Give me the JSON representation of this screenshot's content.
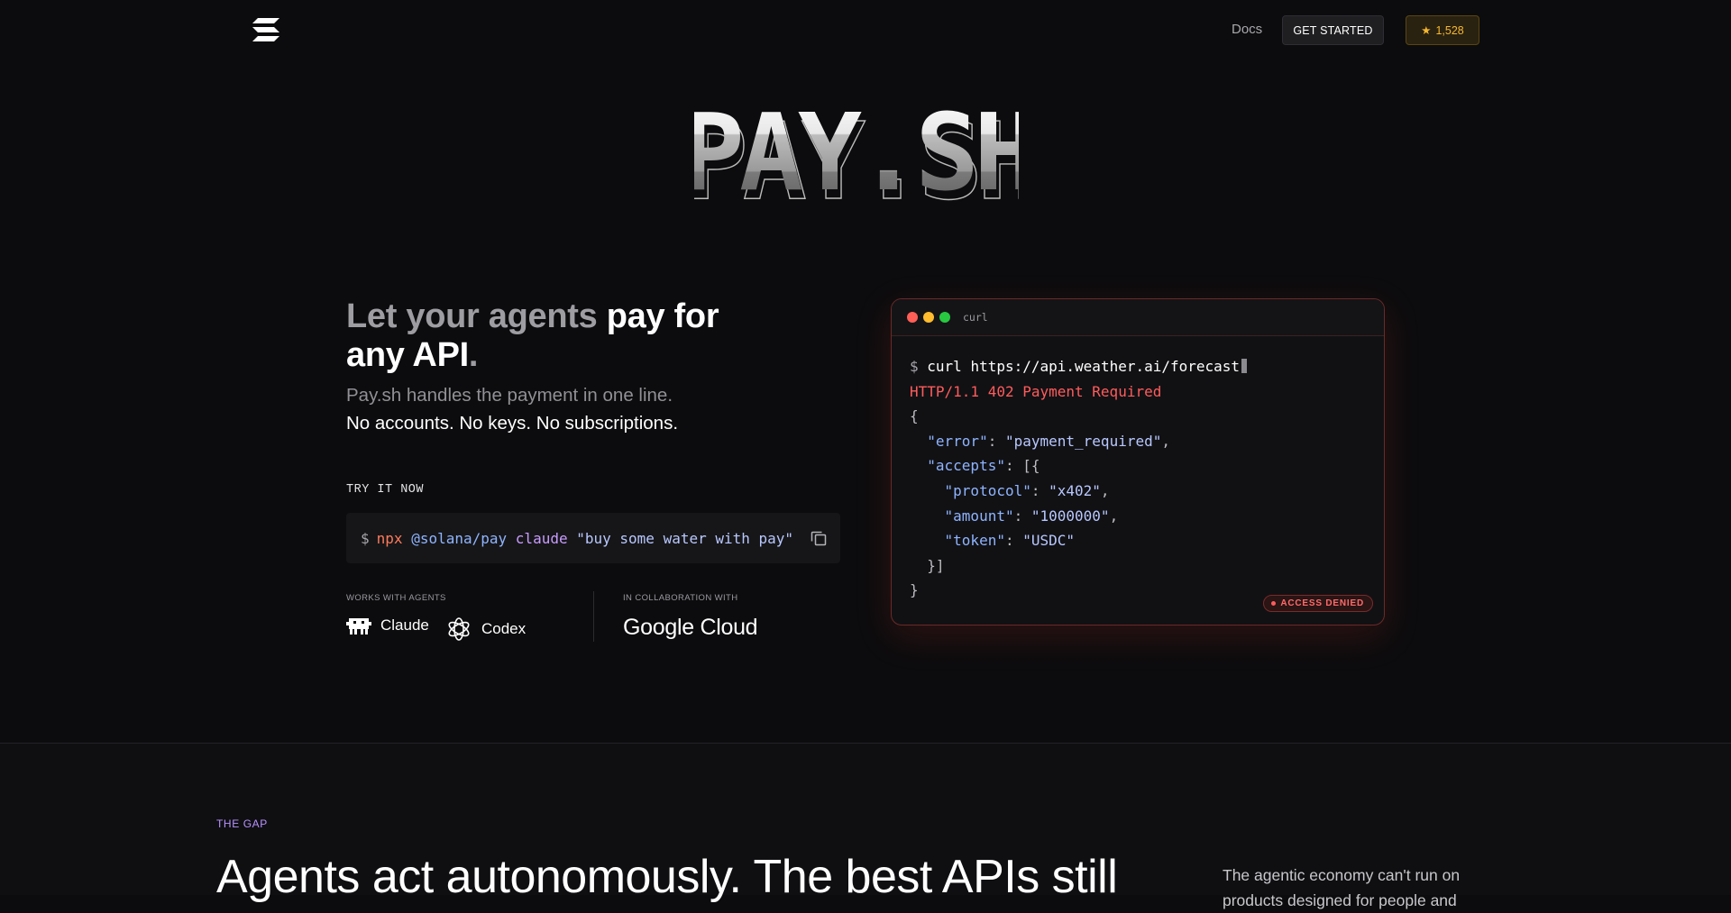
{
  "nav": {
    "logo_icon": "solana-logo-icon",
    "docs_label": "Docs",
    "get_started_label": "GET STARTED",
    "stars_icon": "star-icon",
    "stars_count": "1,528"
  },
  "brand": {
    "title": "PAY.SH"
  },
  "hero": {
    "headline_dim": "Let your agents",
    "headline_bright_1": " pay for any API",
    "headline_dot": ".",
    "sub1": "Pay.sh handles the payment in one line.",
    "sub2": "No accounts. No keys. No subscriptions.",
    "try_label": "TRY IT NOW",
    "command": {
      "prompt": "$",
      "npx": "npx",
      "pkg": "@solana/pay",
      "agent": "claude",
      "arg": "\"buy some water with pay\""
    },
    "copy_icon": "copy-icon",
    "works_label": "WORKS WITH AGENTS",
    "collab_label": "IN COLLABORATION WITH",
    "agents": [
      {
        "name": "Claude",
        "icon": "claude-robot-icon"
      },
      {
        "name": "Codex",
        "icon": "openai-icon"
      }
    ],
    "partner": "Google Cloud"
  },
  "terminal": {
    "title": "curl",
    "prompt": "$",
    "command": "curl https://api.weather.ai/forecast",
    "status": "HTTP/1.1 402 Payment Required",
    "open_brace": "{",
    "error_key": "\"error\"",
    "error_val": "\"payment_required\"",
    "accepts_key": "\"accepts\"",
    "protocol_key": "\"protocol\"",
    "protocol_val": "\"x402\"",
    "amount_key": "\"amount\"",
    "amount_val": "\"1000000\"",
    "token_key": "\"token\"",
    "token_val": "\"USDC\"",
    "close_arr": "}]",
    "close_brace": "}",
    "badge": "ACCESS DENIED",
    "dot_colors": [
      "#ff5f57",
      "#febc2e",
      "#28c840"
    ]
  },
  "gap": {
    "label": "THE GAP",
    "heading": "Agents act autonomously. The best APIs still",
    "side_text": "The agentic economy can't run on products designed for people and"
  }
}
